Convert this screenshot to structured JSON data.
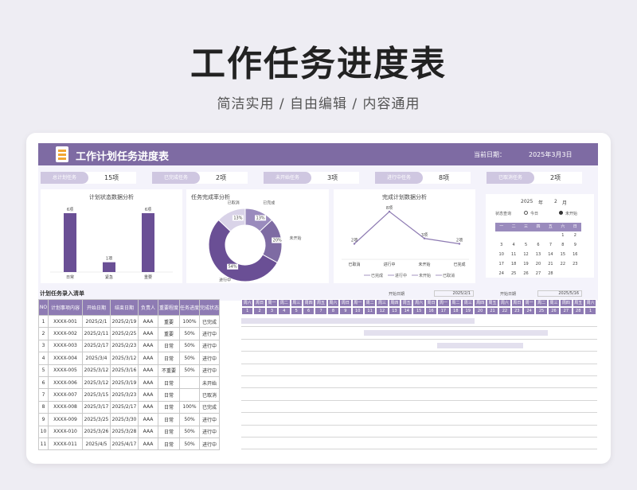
{
  "hero": {
    "title": "工作任务进度表",
    "subtitle": "简洁实用 / 自由编辑 / 内容通用"
  },
  "sheet": {
    "title": "工作计划任务进度表",
    "date_label": "当前日期：",
    "date_value": "2025年3月3日"
  },
  "stats": [
    {
      "label": "总计划任务",
      "value": "15项"
    },
    {
      "label": "已完成任务",
      "value": "2项"
    },
    {
      "label": "未开始任务",
      "value": "3项"
    },
    {
      "label": "进行中任务",
      "value": "8项"
    },
    {
      "label": "已取消任务",
      "value": "2项"
    }
  ],
  "status_chart": {
    "title": "计划状态数据分析",
    "chart_data": {
      "type": "bar",
      "categories": [
        "日常",
        "紧急",
        "重要"
      ],
      "values": [
        6,
        1,
        6
      ],
      "value_labels": [
        "6项",
        "1项",
        "6项"
      ]
    }
  },
  "completion_chart": {
    "title": "任务完成率分析",
    "chart_data": {
      "type": "pie",
      "labels": [
        "已完成",
        "未开始",
        "进行中",
        "已取消"
      ],
      "values": [
        13,
        20,
        54,
        13
      ],
      "value_labels": [
        "13%",
        "20%",
        "54%",
        "13%"
      ],
      "colors": [
        "#9a8bbd",
        "#7e6ba3",
        "#6a4f95",
        "#d9d3e8"
      ]
    }
  },
  "plan_chart": {
    "title": "完成计划数据分析",
    "chart_data": {
      "type": "line",
      "categories": [
        "已取消",
        "进行中",
        "未开始",
        "已完成"
      ],
      "values": [
        2,
        8,
        3,
        2
      ],
      "value_labels": [
        "2项",
        "8项",
        "3项",
        "2项"
      ],
      "legend": [
        "已完成",
        "进行中",
        "未开始",
        "已取消"
      ]
    }
  },
  "calendar": {
    "year": "2025",
    "year_unit": "年",
    "month": "2",
    "month_unit": "月",
    "query_label": "状态查询",
    "legend_today": "今日",
    "legend_done": "未开始",
    "weekdays": [
      "一",
      "二",
      "三",
      "四",
      "五",
      "六",
      "日"
    ],
    "days": [
      "",
      "",
      "",
      "",
      "",
      "1",
      "2",
      "3",
      "4",
      "5",
      "6",
      "7",
      "8",
      "9",
      "10",
      "11",
      "12",
      "13",
      "14",
      "15",
      "16",
      "17",
      "18",
      "19",
      "20",
      "21",
      "22",
      "23",
      "24",
      "25",
      "26",
      "27",
      "28",
      "",
      ""
    ]
  },
  "list": {
    "title": "计划任务录入清单",
    "start_label": "开始日期",
    "start_value": "2025/2/1",
    "start_label2": "开始日期",
    "start_value2": "2025/5/16",
    "columns": [
      "NO",
      "计划事项内容",
      "开始日期",
      "结束日期",
      "负责人",
      "重要程度",
      "任务进度",
      "完成状态"
    ],
    "rows": [
      [
        "1",
        "XXXX-001",
        "2025/2/1",
        "2025/2/19",
        "AAA",
        "重要",
        "100%",
        "已完成"
      ],
      [
        "2",
        "XXXX-002",
        "2025/2/11",
        "2025/2/25",
        "AAA",
        "重要",
        "50%",
        "进行中"
      ],
      [
        "3",
        "XXXX-003",
        "2025/2/17",
        "2025/2/23",
        "AAA",
        "日常",
        "50%",
        "进行中"
      ],
      [
        "4",
        "XXXX-004",
        "2025/3/4",
        "2025/3/12",
        "AAA",
        "日常",
        "50%",
        "进行中"
      ],
      [
        "5",
        "XXXX-005",
        "2025/3/12",
        "2025/3/16",
        "AAA",
        "不重要",
        "50%",
        "进行中"
      ],
      [
        "6",
        "XXXX-006",
        "2025/3/12",
        "2025/3/19",
        "AAA",
        "日常",
        "",
        "未开始"
      ],
      [
        "7",
        "XXXX-007",
        "2025/3/15",
        "2025/3/23",
        "AAA",
        "日常",
        "",
        "已取消"
      ],
      [
        "8",
        "XXXX-008",
        "2025/3/17",
        "2025/2/17",
        "AAA",
        "日常",
        "100%",
        "已完成"
      ],
      [
        "9",
        "XXXX-009",
        "2025/3/25",
        "2025/3/30",
        "AAA",
        "日常",
        "50%",
        "进行中"
      ],
      [
        "10",
        "XXXX-010",
        "2025/3/26",
        "2025/3/28",
        "AAA",
        "日常",
        "50%",
        "进行中"
      ],
      [
        "11",
        "XXXX-011",
        "2025/4/5",
        "2025/4/17",
        "AAA",
        "日常",
        "50%",
        "进行中"
      ]
    ],
    "gantt_weekdays": [
      "周六",
      "周日",
      "周一",
      "周二",
      "周三",
      "周四",
      "周五",
      "周六",
      "周日",
      "周一",
      "周二",
      "周三",
      "周四",
      "周五",
      "周六",
      "周日",
      "周一",
      "周二",
      "周三",
      "周四",
      "周五",
      "周六",
      "周日",
      "周一",
      "周二",
      "周三",
      "周四",
      "周五",
      "周六"
    ],
    "gantt_days": [
      "1",
      "2",
      "3",
      "4",
      "5",
      "6",
      "7",
      "8",
      "9",
      "10",
      "11",
      "12",
      "13",
      "14",
      "15",
      "16",
      "17",
      "18",
      "19",
      "20",
      "21",
      "22",
      "23",
      "24",
      "25",
      "26",
      "27",
      "28",
      "1"
    ],
    "gantt_bars": [
      [
        0,
        19
      ],
      [
        10,
        15
      ],
      [
        16,
        7
      ],
      null,
      null,
      null,
      null,
      null,
      null,
      null,
      null
    ]
  }
}
